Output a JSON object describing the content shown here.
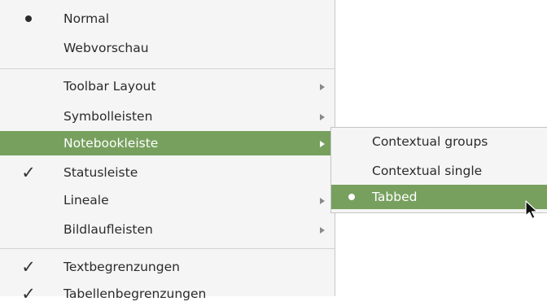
{
  "menu": {
    "items": [
      {
        "label": "Normal",
        "mark": "dot",
        "arrow": false,
        "active": false
      },
      {
        "label": "Webvorschau",
        "mark": "",
        "arrow": false,
        "active": false
      },
      {
        "label": "Toolbar Layout",
        "mark": "",
        "arrow": true,
        "active": false
      },
      {
        "label": "Symbolleisten",
        "mark": "",
        "arrow": true,
        "active": false
      },
      {
        "label": "Notebookleiste",
        "mark": "",
        "arrow": true,
        "active": true
      },
      {
        "label": "Statusleiste",
        "mark": "check",
        "arrow": false,
        "active": false
      },
      {
        "label": "Lineale",
        "mark": "",
        "arrow": true,
        "active": false
      },
      {
        "label": "Bildlaufleisten",
        "mark": "",
        "arrow": true,
        "active": false
      },
      {
        "label": "Textbegrenzungen",
        "mark": "check",
        "arrow": false,
        "active": false
      },
      {
        "label": "Tabellenbegrenzungen",
        "mark": "check",
        "arrow": false,
        "active": false
      }
    ]
  },
  "submenu": {
    "items": [
      {
        "label": "Contextual groups",
        "mark": "",
        "active": false
      },
      {
        "label": "Contextual single",
        "mark": "",
        "active": false
      },
      {
        "label": "Tabbed",
        "mark": "dot",
        "active": true
      }
    ]
  },
  "colors": {
    "highlight": "#77a05e",
    "menu_bg": "#f5f5f5",
    "text": "#2b2b2b"
  },
  "icons": {
    "check": "check-icon",
    "dot": "radio-dot-icon",
    "arrow": "submenu-arrow-icon",
    "cursor": "mouse-pointer-icon"
  }
}
